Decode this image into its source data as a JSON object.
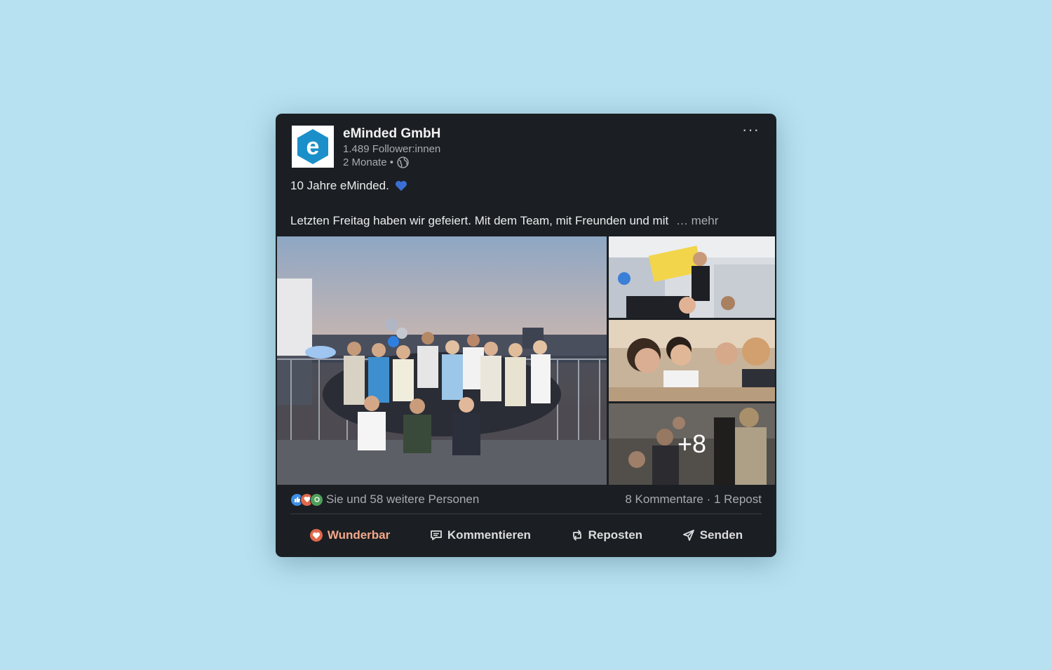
{
  "post": {
    "company_name": "eMinded GmbH",
    "followers": "1.489 Follower:innen",
    "time_ago": "2 Monate •",
    "text_line1": "10 Jahre eMinded.",
    "text_line2": "Letzten Freitag haben wir gefeiert. Mit dem Team, mit Freunden und mit",
    "more_label": "… mehr",
    "extra_photos": "+8"
  },
  "stats": {
    "reactions_text": "Sie und 58 weitere Personen",
    "comments_reposts": "8 Kommentare · 1 Repost"
  },
  "actions": {
    "like": "Wunderbar",
    "comment": "Kommentieren",
    "repost": "Reposten",
    "send": "Senden"
  },
  "colors": {
    "page_bg": "#b7e1f0",
    "card_bg": "#1b1f23",
    "logo_blue": "#1a8fc9",
    "liked_accent": "#f4a889"
  },
  "icons": [
    "more-options-icon",
    "globe-icon",
    "blue-heart-icon",
    "like-reaction-icon",
    "love-reaction-icon",
    "celebrate-reaction-icon",
    "heart-icon",
    "comment-icon",
    "repost-icon",
    "send-icon"
  ]
}
